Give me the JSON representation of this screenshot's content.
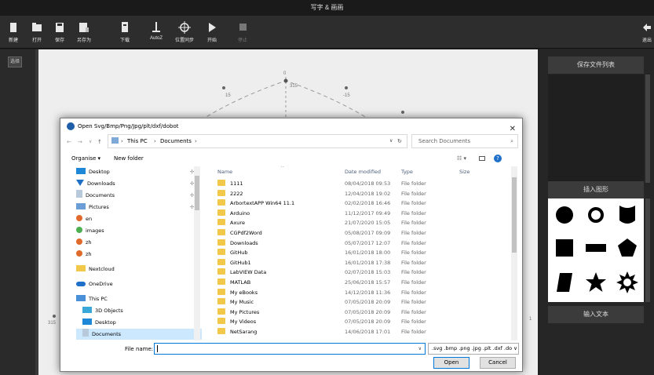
{
  "window": {
    "title": "写字 & 画画"
  },
  "toolbar": {
    "items": [
      {
        "label": "新建"
      },
      {
        "label": "打开"
      },
      {
        "label": "保存"
      },
      {
        "label": "另存为"
      },
      {
        "label": "下载"
      },
      {
        "label": "AutoZ"
      },
      {
        "label": "位置同步"
      },
      {
        "label": "开始"
      },
      {
        "label": "停止"
      },
      {
        "label": "退出"
      }
    ]
  },
  "left_tools": {
    "select_label": "选择"
  },
  "canvas": {
    "scale_labels": [
      "0",
      "315",
      "15",
      "-15",
      "315",
      "1"
    ]
  },
  "right_panel": {
    "save_list_label": "保存文件列表",
    "insert_shape_label": "插入图形",
    "input_text_label": "输入文本"
  },
  "dialog": {
    "title": "Open Svg/Bmp/Png/Jpg/plt/dxf/dobot",
    "breadcrumb": [
      "This PC",
      "Documents"
    ],
    "search_placeholder": "Search Documents",
    "organise_label": "Organise ▾",
    "new_folder_label": "New folder",
    "nav_items": [
      {
        "label": "Desktop"
      },
      {
        "label": "Downloads"
      },
      {
        "label": "Documents"
      },
      {
        "label": "Pictures"
      },
      {
        "label": "en"
      },
      {
        "label": "images"
      },
      {
        "label": "zh"
      },
      {
        "label": "zh"
      },
      {
        "label": "Nextcloud"
      },
      {
        "label": "OneDrive"
      },
      {
        "label": "This PC"
      },
      {
        "label": "3D Objects"
      },
      {
        "label": "Desktop"
      },
      {
        "label": "Documents"
      }
    ],
    "columns": {
      "name": "Name",
      "date": "Date modified",
      "type": "Type",
      "size": "Size"
    },
    "files": [
      {
        "name": "1111",
        "date": "08/04/2018 09:53",
        "type": "File folder"
      },
      {
        "name": "2222",
        "date": "12/04/2018 19:02",
        "type": "File folder"
      },
      {
        "name": "ArbortextAPP Win64 11.1",
        "date": "02/02/2018 16:46",
        "type": "File folder"
      },
      {
        "name": "Arduino",
        "date": "11/12/2017 09:49",
        "type": "File folder"
      },
      {
        "name": "Axure",
        "date": "21/07/2020 15:05",
        "type": "File folder"
      },
      {
        "name": "CGPdf2Word",
        "date": "05/08/2017 09:09",
        "type": "File folder"
      },
      {
        "name": "Downloads",
        "date": "05/07/2017 12:07",
        "type": "File folder"
      },
      {
        "name": "GitHub",
        "date": "16/01/2018 18:00",
        "type": "File folder"
      },
      {
        "name": "GitHub1",
        "date": "16/01/2018 17:38",
        "type": "File folder"
      },
      {
        "name": "LabVIEW Data",
        "date": "02/07/2018 15:03",
        "type": "File folder"
      },
      {
        "name": "MATLAB",
        "date": "25/06/2018 15:57",
        "type": "File folder"
      },
      {
        "name": "My eBooks",
        "date": "14/12/2018 11:36",
        "type": "File folder"
      },
      {
        "name": "My Music",
        "date": "07/05/2018 20:09",
        "type": "File folder"
      },
      {
        "name": "My Pictures",
        "date": "07/05/2018 20:09",
        "type": "File folder"
      },
      {
        "name": "My Videos",
        "date": "07/05/2018 20:09",
        "type": "File folder"
      },
      {
        "name": "NetSarang",
        "date": "14/06/2018 17:01",
        "type": "File folder"
      }
    ],
    "file_name_label": "File name:",
    "file_name_value": "",
    "file_type_value": ".svg .bmp .png .jpg .plt .dxf .do ∨",
    "open_label": "Open",
    "cancel_label": "Cancel"
  }
}
